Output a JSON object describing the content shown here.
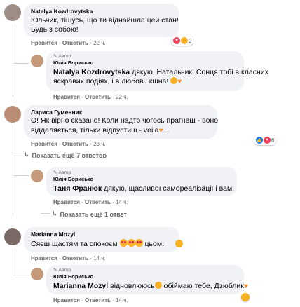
{
  "comments": [
    {
      "author": "Natalya Kozdrovytska",
      "text_lines": [
        "Юльчик, тішусь, що ти віднайшла цей стан!",
        "Будь з собою!"
      ],
      "like_label": "Нравится",
      "reply_label": "Ответить",
      "time": "22 ч.",
      "reaction_count": "2"
    },
    {
      "author": "Лариса Гуменник",
      "text_lines": [
        "О! Як вірно сказано! Коли надто чогось прагнеш - воно",
        "віддаляється, тільки відпустиш - voila"
      ],
      "like_label": "Нравится",
      "reply_label": "Ответить",
      "time": "23 ч.",
      "reaction_count": "6",
      "more_replies": "Показать ещё 7 ответов"
    },
    {
      "author": "Marianna Mozyl",
      "text_lines": [
        "Сяєш щастям та спокоєм",
        "цьом."
      ],
      "like_label": "Нравится",
      "reply_label": "Ответить",
      "time": "14 ч."
    }
  ],
  "replies": [
    {
      "author_tag": "Автор",
      "author": "Юлія Борисько",
      "mention": "Natalya Kozdrovytska",
      "text_lines": [
        "дякую, Натальчик! Сонця тобі в класних",
        "яскравих подіях, і в любові, кшна!"
      ],
      "like_label": "Нравится",
      "reply_label": "Ответить",
      "time": "22 ч."
    },
    {
      "author_tag": "Автор",
      "author": "Юлія Борисько",
      "mention": "Таня Франюк",
      "text": "дякую, щасливої самореалізації і вам!",
      "like_label": "Нравится",
      "reply_label": "Ответить",
      "time": "14 ч.",
      "more_replies": "Показать ещё 1 ответ"
    },
    {
      "author_tag": "Автор",
      "author": "Юлія Борисько",
      "mention": "Marianna Mozyl",
      "text_a": "відновлююсь",
      "text_b": "обіймаю тебе, Дзюблик",
      "like_label": "Нравится",
      "reply_label": "Ответить",
      "time": "14 ч."
    }
  ],
  "colors": {
    "bubble": "#f0f2f5",
    "meta": "#65676b",
    "like": "#1877f2",
    "heart": "#f33e58"
  }
}
